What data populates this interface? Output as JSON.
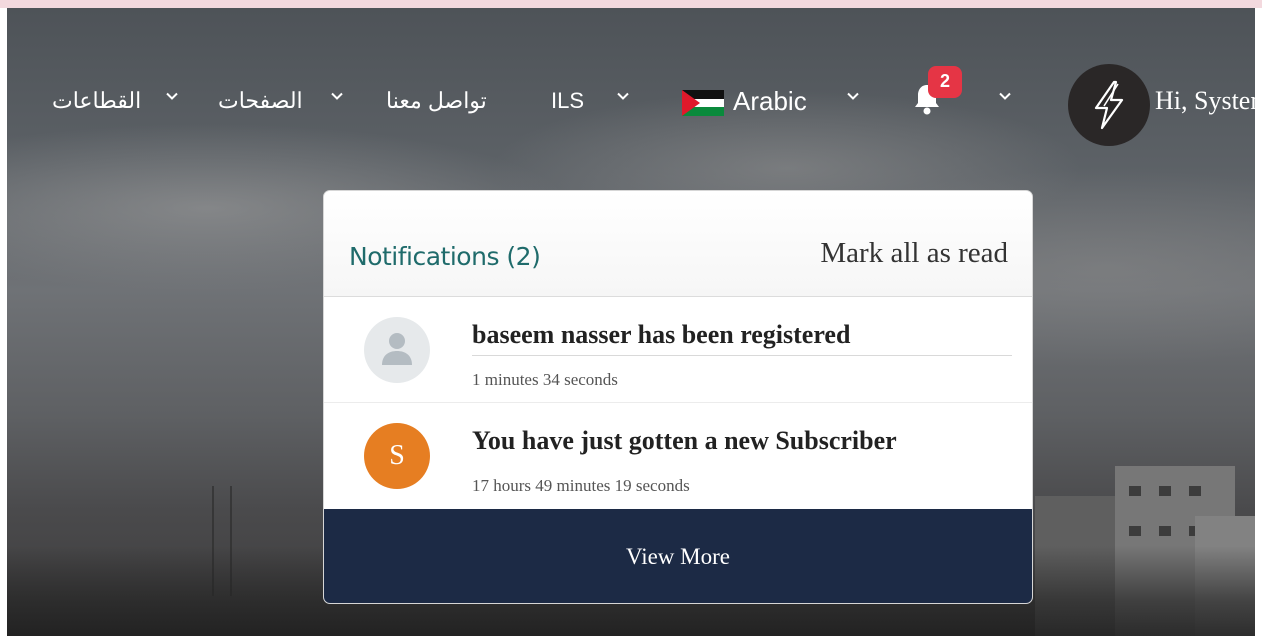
{
  "nav": {
    "items": [
      {
        "label": "القطاعات"
      },
      {
        "label": "الصفحات"
      },
      {
        "label": "تواصل معنا"
      },
      {
        "label": "ILS"
      },
      {
        "label": "Arabic"
      }
    ],
    "notification_count": "2",
    "greeting": "Hi, System",
    "flag_icon": "palestine-flag-icon",
    "bell_icon": "bell-icon",
    "avatar_icon": "lightning-bolt-icon"
  },
  "notifications": {
    "title": "Notifications (2)",
    "mark_all_label": "Mark all as read",
    "items": [
      {
        "avatar": "",
        "avatar_icon": "user-silhouette-icon",
        "title": "baseem nasser has been registered",
        "time": "1 minutes 34 seconds"
      },
      {
        "avatar": "S",
        "title": "You have just gotten a new Subscriber",
        "time": "17 hours 49 minutes 19 seconds"
      }
    ],
    "view_more_label": "View More"
  },
  "colors": {
    "title_teal": "#1f6b6b",
    "badge_red": "#e53545",
    "view_more_navy": "#1c2a45",
    "avatar_orange": "#e67e22"
  }
}
